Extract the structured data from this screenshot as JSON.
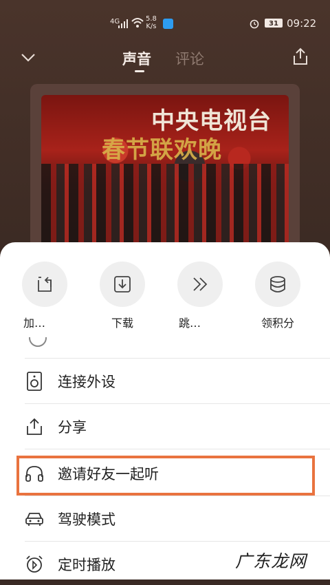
{
  "status_bar": {
    "network": "4G",
    "speed_value": "5.8",
    "speed_unit": "K/s",
    "battery": "31",
    "time": "09:22"
  },
  "nav": {
    "tab_voice": "声音",
    "tab_comment": "评论"
  },
  "cover": {
    "title": "中央电视台",
    "subtitle": "春节联欢晚"
  },
  "actions": [
    {
      "label": "加…",
      "icon": "add-to-playlist-icon"
    },
    {
      "label": "下载",
      "icon": "download-icon"
    },
    {
      "label": "跳…",
      "icon": "skip-icon"
    },
    {
      "label": "领积分",
      "icon": "coins-icon"
    }
  ],
  "menu": [
    {
      "label": "连接外设",
      "icon": "speaker-icon"
    },
    {
      "label": "分享",
      "icon": "share-icon"
    },
    {
      "label": "邀请好友一起听",
      "icon": "headphones-icon"
    },
    {
      "label": "驾驶模式",
      "icon": "car-icon"
    },
    {
      "label": "定时播放",
      "icon": "alarm-clock-icon"
    }
  ],
  "watermark": "广东龙网",
  "colors": {
    "highlight": "#e9733f",
    "sheet_bg": "#ffffff",
    "backdrop": "#3b2a23"
  }
}
